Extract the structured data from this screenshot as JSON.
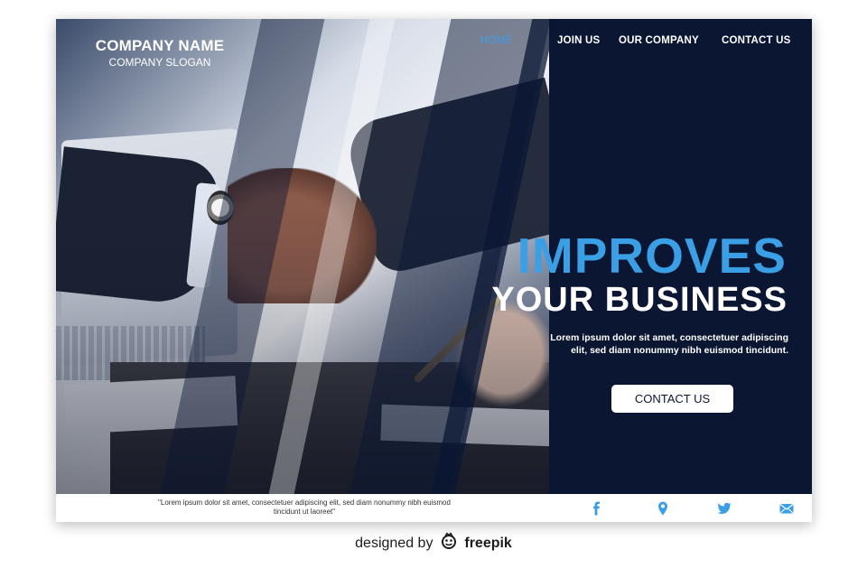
{
  "brand": {
    "name": "COMPANY NAME",
    "slogan": "COMPANY SLOGAN"
  },
  "nav": {
    "items": [
      {
        "label": "HOME",
        "active": true
      },
      {
        "label": "JOIN US",
        "active": false
      },
      {
        "label": "OUR COMPANY",
        "active": false
      },
      {
        "label": "CONTACT US",
        "active": false
      }
    ]
  },
  "hero": {
    "headline_1": "IMPROVES",
    "headline_2": "YOUR BUSINESS",
    "body_line_1": "Lorem ipsum dolor sit amet, consectetuer adipiscing",
    "body_line_2": "elit, sed diam nonummy nibh euismod tincidunt.",
    "cta_label": "CONTACT US"
  },
  "footer": {
    "quote_line_1": "\"Lorem ipsum dolor sit amet, consectetuer adipiscing elit, sed diam nonummy nibh euismod",
    "quote_line_2": "tincidunt ut laoreet\"",
    "social_icons": [
      "facebook-icon",
      "location-pin-icon",
      "twitter-icon",
      "mail-icon"
    ]
  },
  "credit": {
    "prefix": "designed by",
    "brand": "freepik"
  },
  "colors": {
    "navy": "#0b1633",
    "accent_blue": "#3b9fe6",
    "white": "#ffffff"
  }
}
